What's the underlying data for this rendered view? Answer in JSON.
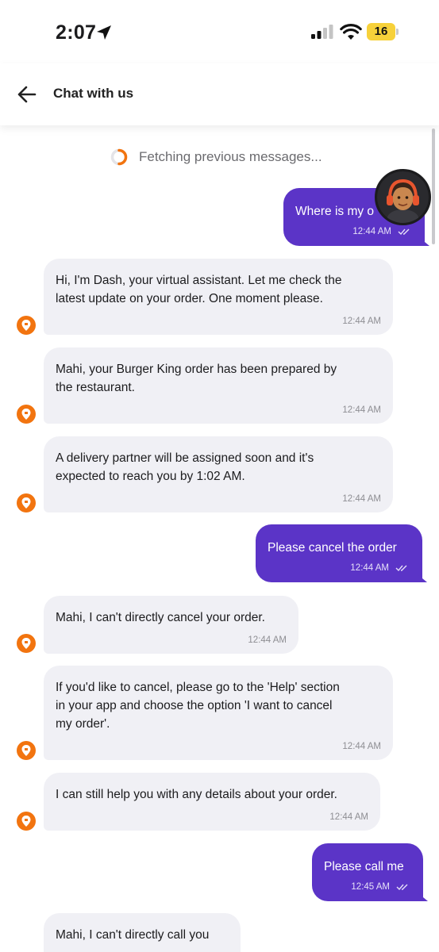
{
  "status_bar": {
    "time": "2:07",
    "battery_level": "16",
    "icons": [
      "location-arrow-icon",
      "cellular-signal-icon",
      "wifi-icon",
      "battery-icon"
    ]
  },
  "header": {
    "title": "Chat with us",
    "back_icon": "arrow-left-icon"
  },
  "chat": {
    "loading_text": "Fetching previous messages...",
    "messages": [
      {
        "sender": "user",
        "text": "Where is my o",
        "time": "12:44 AM"
      },
      {
        "sender": "bot",
        "text": "Hi, I'm Dash, your virtual assistant. Let me check the\nlatest update on your order. One moment please.",
        "time": "12:44 AM"
      },
      {
        "sender": "bot",
        "text": "Mahi, your Burger King order has been prepared by\nthe restaurant.",
        "time": "12:44 AM"
      },
      {
        "sender": "bot",
        "text": "A delivery partner will be assigned soon and it's\nexpected to reach you by 1:02 AM.",
        "time": "12:44 AM"
      },
      {
        "sender": "user",
        "text": "Please cancel the order",
        "time": "12:44 AM"
      },
      {
        "sender": "bot",
        "text": "Mahi, I can't directly cancel your order.",
        "time": "12:44 AM"
      },
      {
        "sender": "bot",
        "text": "If you'd like to cancel, please go to the 'Help' section\nin your app and choose the option 'I want to cancel\nmy order'.",
        "time": "12:44 AM"
      },
      {
        "sender": "bot",
        "text": "I can still help you with any details about your order.",
        "time": "12:44 AM"
      },
      {
        "sender": "user",
        "text": "Please call me",
        "time": "12:45 AM"
      },
      {
        "sender": "bot",
        "text": "Mahi, I can't directly call you",
        "time": ""
      }
    ]
  },
  "colors": {
    "user_bubble": "#5b34c7",
    "bot_bubble": "#f0f0f5",
    "bot_avatar": "#f2740f",
    "spinner_accent": "#f2740f"
  }
}
